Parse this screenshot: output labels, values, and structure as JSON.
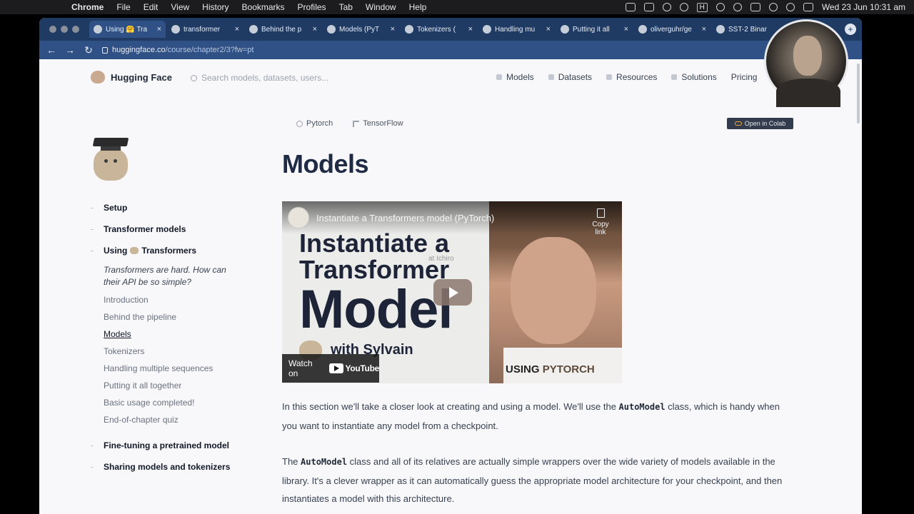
{
  "macos_menubar": {
    "app_name": "Chrome",
    "menus": [
      "File",
      "Edit",
      "View",
      "History",
      "Bookmarks",
      "Profiles",
      "Tab",
      "Window",
      "Help"
    ],
    "status_tag": "H",
    "clock": "Wed 23 Jun  10:31 am"
  },
  "browser": {
    "tabs": [
      {
        "label": "Using 🤗 Tra",
        "icon": "hf-favicon",
        "active": true
      },
      {
        "label": "transformer",
        "icon": "github-favicon"
      },
      {
        "label": "Behind the p",
        "icon": "hf-favicon"
      },
      {
        "label": "Models (PyT",
        "icon": "colab-favicon"
      },
      {
        "label": "Tokenizers (",
        "icon": "colab-favicon"
      },
      {
        "label": "Handling mu",
        "icon": "colab-favicon"
      },
      {
        "label": "Putting it all",
        "icon": "colab-favicon"
      },
      {
        "label": "oliverguhr/ge",
        "icon": "hf-favicon"
      },
      {
        "label": "SST-2 Binar",
        "icon": "page-favicon"
      }
    ],
    "url_host": "huggingface.co",
    "url_path": "/course/chapter2/3?fw=pt"
  },
  "header": {
    "brand": "Hugging Face",
    "search_placeholder": "Search models, datasets, users...",
    "nav": [
      "Models",
      "Datasets",
      "Resources",
      "Solutions",
      "Pricing"
    ]
  },
  "sidebar": {
    "sections": [
      {
        "label": "Setup"
      },
      {
        "label": "Transformer models"
      },
      {
        "label_pre": "Using",
        "label_post": "Transformers"
      },
      {
        "label": "Fine-tuning a pretrained model"
      },
      {
        "label": "Sharing models and tokenizers"
      }
    ],
    "chapter_description": "Transformers are hard. How can their API be so simple?",
    "chapter_items": [
      "Introduction",
      "Behind the pipeline",
      "Models",
      "Tokenizers",
      "Handling multiple sequences",
      "Putting it all together",
      "Basic usage completed!",
      "End-of-chapter quiz"
    ],
    "current_item": "Models"
  },
  "content": {
    "framework_tabs": [
      "Pytorch",
      "TensorFlow"
    ],
    "colab_label": "Open in Colab",
    "title": "Models",
    "video": {
      "title": "Instantiate a Transformers model (PyTorch)",
      "copy_label": "Copy link",
      "headline_line1": "Instantiate a",
      "headline_line2": "Transformer",
      "headline_line3": "Model",
      "byline": "with Sylvain",
      "watermark": "at Ichiro",
      "watch_on": "Watch on",
      "youtube": "YouTube",
      "using": "USING",
      "framework": "PYTORCH"
    },
    "paragraph1": {
      "before": "In this section we'll take a closer look at creating and using a model. We'll use the ",
      "code": "AutoModel",
      "after": " class, which is handy when you want to instantiate any model from a checkpoint."
    },
    "paragraph2": {
      "before": "The ",
      "code": "AutoModel",
      "after": " class and all of its relatives are actually simple wrappers over the wide variety of models available in the library. It's a clever wrapper as it can automatically guess the appropriate model architecture for your checkpoint, and then instantiates a model with this architecture."
    }
  }
}
